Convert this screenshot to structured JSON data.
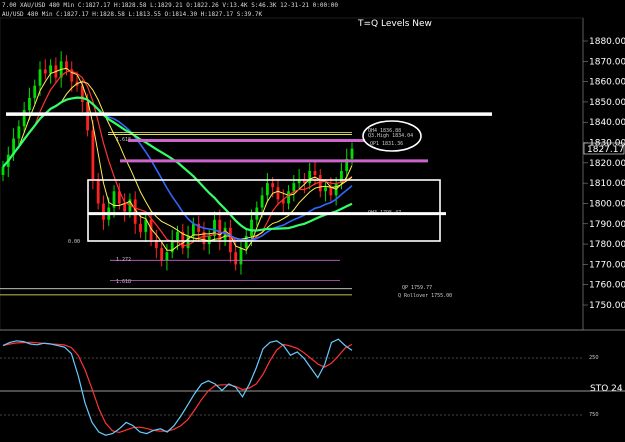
{
  "window": {
    "header": "7.00  XAU/USD 480 Min  C:1827.17  H:1828.58  L:1829.21  O:1822.26  V:13.4K  S:46.3K  12-31-21  0:00:00",
    "header_line2": "AU/USD  480 Min  C:1827.17  H:1828.58  L:1813.55  O:1814.30  H:1827.17  S:39.7K"
  },
  "chart_data": {
    "type": "candlestick",
    "title": "T=Q Levels New",
    "symbol": "XAU/USD",
    "timeframe": "480 Min",
    "yaxis": {
      "ticks": [
        1880,
        1870,
        1860,
        1850,
        1840,
        1830,
        1820,
        1810,
        1800,
        1790,
        1780,
        1770,
        1760,
        1750
      ],
      "ylim": [
        1745,
        1886
      ],
      "labels": [
        "1880.00",
        "1870.00",
        "1860.00",
        "1850.00",
        "1840.00",
        "1830.00",
        "1820.00",
        "1810.00",
        "1800.00",
        "1790.00",
        "1780.00",
        "1770.00",
        "1760.00",
        "1750.00"
      ]
    },
    "current_price": {
      "value": 1827.17,
      "label": "1827.17"
    },
    "close_series": [
      1818,
      1824,
      1832,
      1838,
      1846,
      1852,
      1858,
      1866,
      1864,
      1868,
      1862,
      1870,
      1866,
      1860,
      1858,
      1850,
      1836,
      1812,
      1800,
      1792,
      1798,
      1806,
      1800,
      1796,
      1802,
      1790,
      1786,
      1792,
      1782,
      1778,
      1772,
      1776,
      1782,
      1786,
      1778,
      1784,
      1790,
      1786,
      1780,
      1784,
      1792,
      1782,
      1788,
      1776,
      1770,
      1778,
      1784,
      1792,
      1798,
      1804,
      1810,
      1808,
      1802,
      1800,
      1806,
      1810,
      1812,
      1810,
      1816,
      1814,
      1806,
      1808,
      1804,
      1810,
      1816,
      1822,
      1827
    ],
    "levels": [
      {
        "value": 1844,
        "color": "#ffffff",
        "label": ""
      },
      {
        "value": 1835,
        "color": "#ffff66",
        "label": "QH4 1836.88"
      },
      {
        "value": 1834,
        "color": "#ffff66",
        "label": "Q3.High 1834.04"
      },
      {
        "value": 1831,
        "color": "#cc66cc",
        "label": "QP1 1831.36"
      },
      {
        "value": 1821,
        "color": "#cc66cc",
        "label": ""
      },
      {
        "value": 1795,
        "color": "#ffffff",
        "label": "QH3 1795.47"
      },
      {
        "value": 1758,
        "color": "#ffffff",
        "label": "QP 1759.77"
      },
      {
        "value": 1755,
        "color": "#ffff66",
        "label": "Q Rollover 1755.00"
      }
    ],
    "fib_labels": [
      "1.618",
      "1.272",
      "1.618",
      "0.00"
    ],
    "oscillator": {
      "name": "STO 24",
      "levels": [
        250,
        750
      ],
      "level_labels": [
        "250",
        "750"
      ]
    }
  },
  "colors": {
    "up": "#00dd00",
    "down": "#ff2222",
    "ma_yellow": "#ffee55",
    "ma_red": "#ff3333",
    "ma_blue": "#3366ff",
    "ma_green": "#33ff66",
    "ma_white": "#ffffff",
    "purple": "#cc66cc",
    "cyan": "#66ccff"
  }
}
